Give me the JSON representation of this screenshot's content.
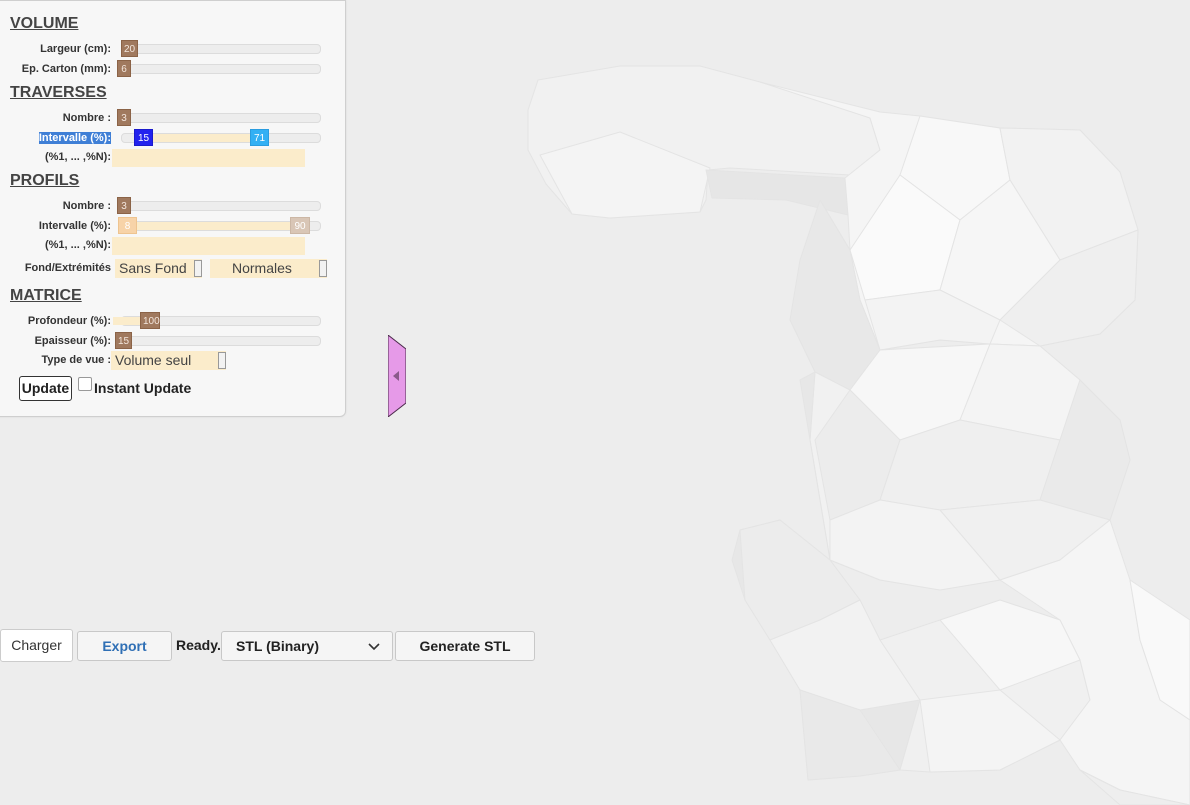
{
  "panel": {
    "volume": {
      "title": "VOLUME",
      "largeur": {
        "label": "Largeur (cm):",
        "value": "20"
      },
      "epaisseur_carton": {
        "label": "Ep. Carton (mm):",
        "value": "6"
      }
    },
    "traverses": {
      "title": "TRAVERSES",
      "nombre": {
        "label": "Nombre :",
        "value": "3"
      },
      "intervalle": {
        "label": "Intervalle (%):",
        "min": "15",
        "max": "71"
      },
      "pourcentages": {
        "label": "(%1, ... ,%N):",
        "value": ""
      }
    },
    "profils": {
      "title": "PROFILS",
      "nombre": {
        "label": "Nombre :",
        "value": "3"
      },
      "intervalle": {
        "label": "Intervalle (%):",
        "min": "8",
        "max": "90"
      },
      "pourcentages": {
        "label": "(%1, ... ,%N):",
        "value": ""
      },
      "fond_extremites": {
        "label": "Fond/Extrémités",
        "fond_value": "Sans Fond",
        "extremites_value": "Normales"
      }
    },
    "matrice": {
      "title": "MATRICE",
      "profondeur": {
        "label": "Profondeur (%):",
        "value": "100"
      },
      "epaisseur": {
        "label": "Epaisseur (%):",
        "value": "15"
      },
      "type_vue": {
        "label": "Type de vue :",
        "value": "Volume seul"
      }
    },
    "update_label": "Update",
    "instant_update": {
      "label": "Instant Update",
      "checked": false
    }
  },
  "toolbar": {
    "charger_label": "Charger",
    "export_label": "Export",
    "status_text": "Ready.",
    "format_select_value": "STL (Binary)",
    "generate_label": "Generate STL"
  },
  "colors": {
    "background": "#ededed",
    "slider_handle": "#a0795e",
    "field_fill": "#fbeccb",
    "range_min_handle": "#2222ee",
    "range_max_handle": "#33b0f4",
    "collapse_tab": "#e69ae8",
    "export_text": "#2f6fb5"
  },
  "icons": {
    "collapse": "triangle-left-icon",
    "dropdown": "chevron-down-icon"
  }
}
